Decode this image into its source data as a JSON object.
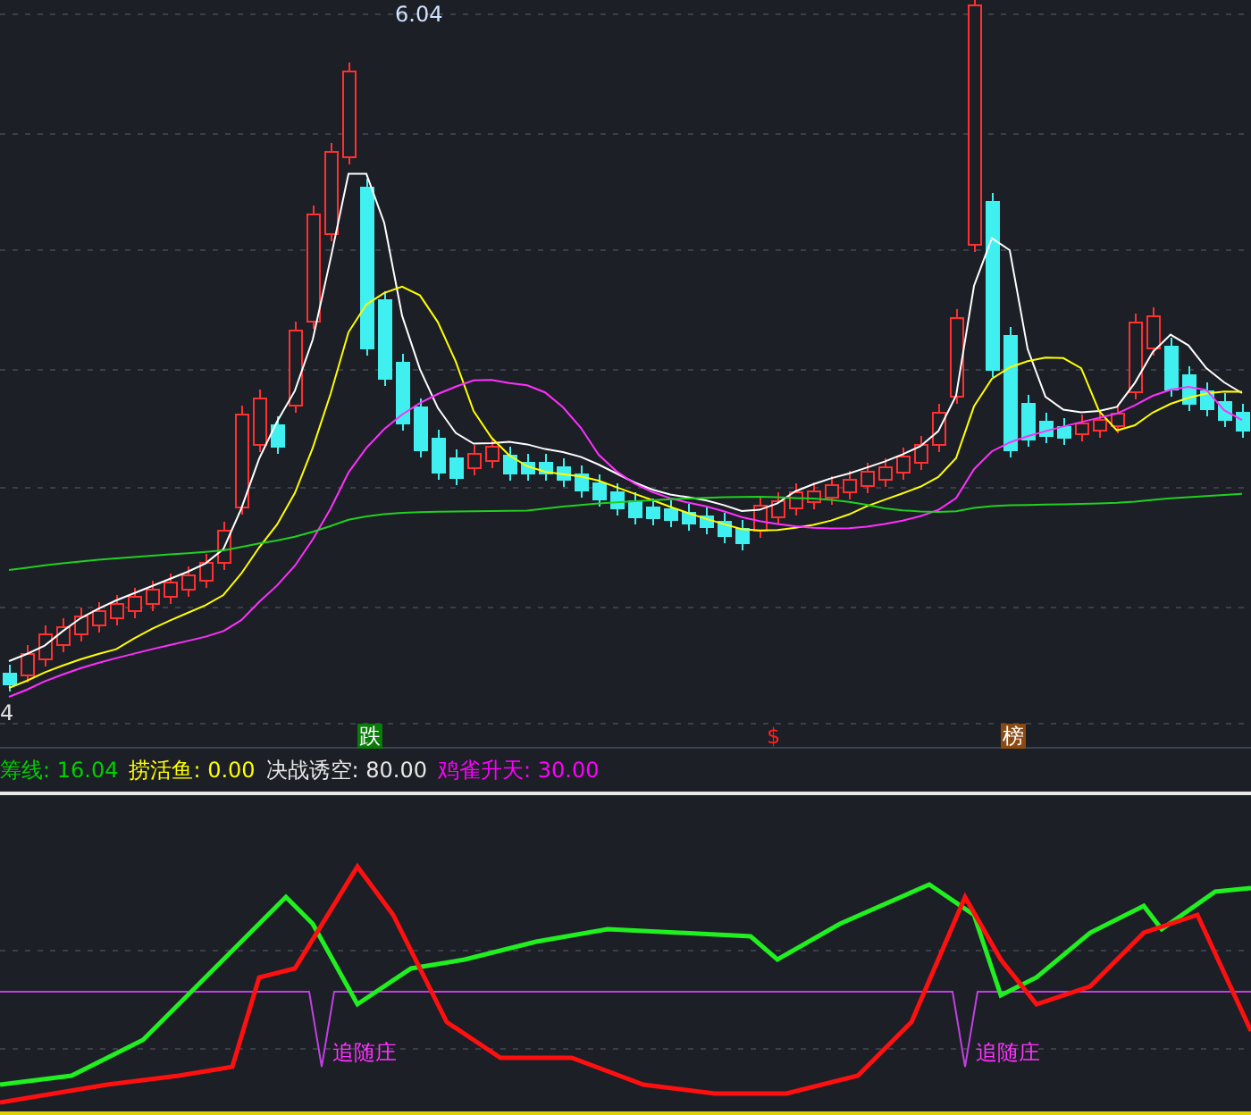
{
  "price_chart": {
    "high_label": "6.04",
    "low_label": "4",
    "markers": [
      {
        "text": "跌",
        "kind": "box",
        "color": "#0a7a0a"
      },
      {
        "text": "$",
        "kind": "plain",
        "color": "#ff2020"
      },
      {
        "text": "榜",
        "kind": "box",
        "color": "#8a4a10"
      }
    ]
  },
  "legend": [
    {
      "text": "筹线: 16.04",
      "color": "#00d000"
    },
    {
      "text": "捞活鱼: 0.00",
      "color": "#ffff00"
    },
    {
      "text": "决战诱空: 80.00",
      "color": "#e8e8e8"
    },
    {
      "text": "鸡雀升天: 30.00",
      "color": "#ff00ff"
    }
  ],
  "indicator": {
    "labels": [
      "追随庄",
      "追随庄"
    ]
  }
}
